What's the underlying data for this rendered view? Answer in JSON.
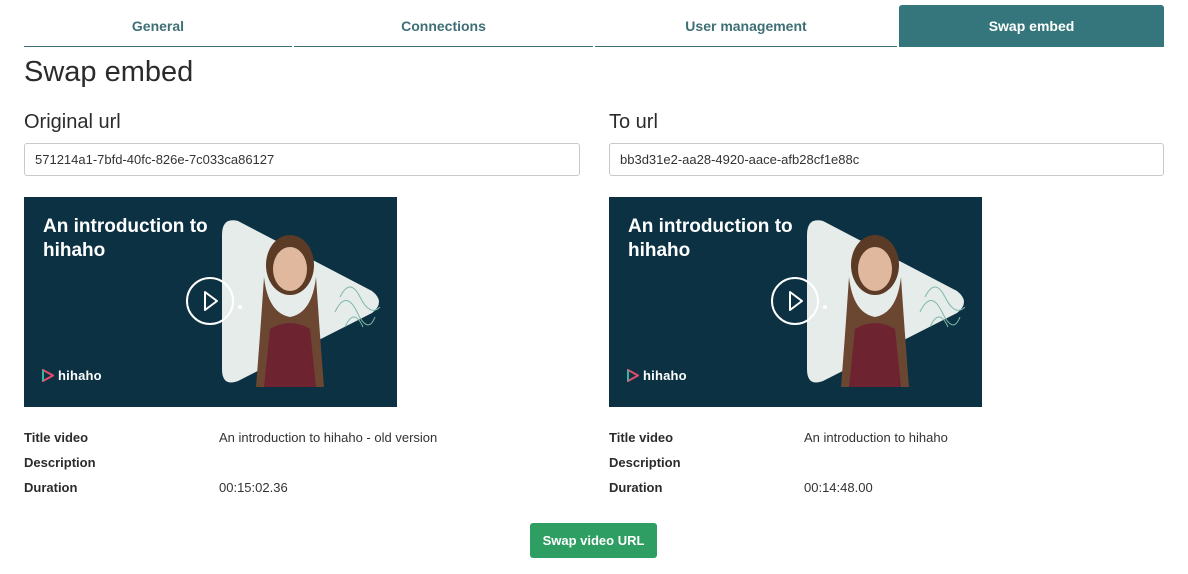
{
  "tabs": [
    {
      "label": "General"
    },
    {
      "label": "Connections"
    },
    {
      "label": "User management"
    },
    {
      "label": "Swap embed"
    }
  ],
  "page": {
    "title": "Swap embed"
  },
  "original": {
    "label": "Original url",
    "url_value": "571214a1-7bfd-40fc-826e-7c033ca86127",
    "thumbnail": {
      "heading": "An introduction to hihaho",
      "brand": "hihaho"
    },
    "meta": {
      "title_key": "Title video",
      "title_value": "An introduction to hihaho - old version",
      "description_key": "Description",
      "description_value": "",
      "duration_key": "Duration",
      "duration_value": "00:15:02.36"
    }
  },
  "target": {
    "label": "To url",
    "url_value": "bb3d31e2-aa28-4920-aace-afb28cf1e88c",
    "thumbnail": {
      "heading": "An introduction to hihaho",
      "brand": "hihaho"
    },
    "meta": {
      "title_key": "Title video",
      "title_value": "An introduction to hihaho",
      "description_key": "Description",
      "description_value": "",
      "duration_key": "Duration",
      "duration_value": "00:14:48.00"
    }
  },
  "actions": {
    "swap_label": "Swap video URL"
  },
  "colors": {
    "tab_accent": "#34767b",
    "thumb_bg": "#0b3142",
    "swap_button": "#2e9e63"
  }
}
